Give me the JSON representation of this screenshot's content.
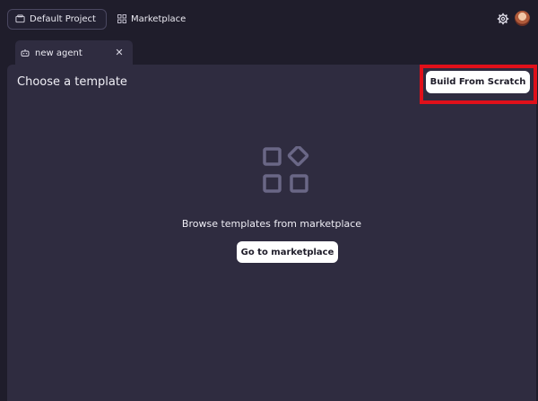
{
  "header": {
    "project_label": "Default Project",
    "project_icon": "folder-icon",
    "marketplace_label": "Marketplace",
    "marketplace_icon": "grid-icon",
    "settings_icon": "gear-icon",
    "avatar_icon": "user-avatar"
  },
  "tabs": [
    {
      "label": "new agent",
      "icon": "agent-icon",
      "close_icon": "close-icon"
    }
  ],
  "panel": {
    "title": "Choose a template",
    "build_button": "Build From Scratch",
    "empty_state": {
      "icon": "shapes-grid-icon",
      "text": "Browse templates from marketplace",
      "button": "Go to marketplace"
    }
  },
  "colors": {
    "background": "#1f1d2b",
    "panel": "#2f2c40",
    "highlight": "#e0101a",
    "button_bg": "#ffffff",
    "icon_muted": "#6a6786"
  }
}
